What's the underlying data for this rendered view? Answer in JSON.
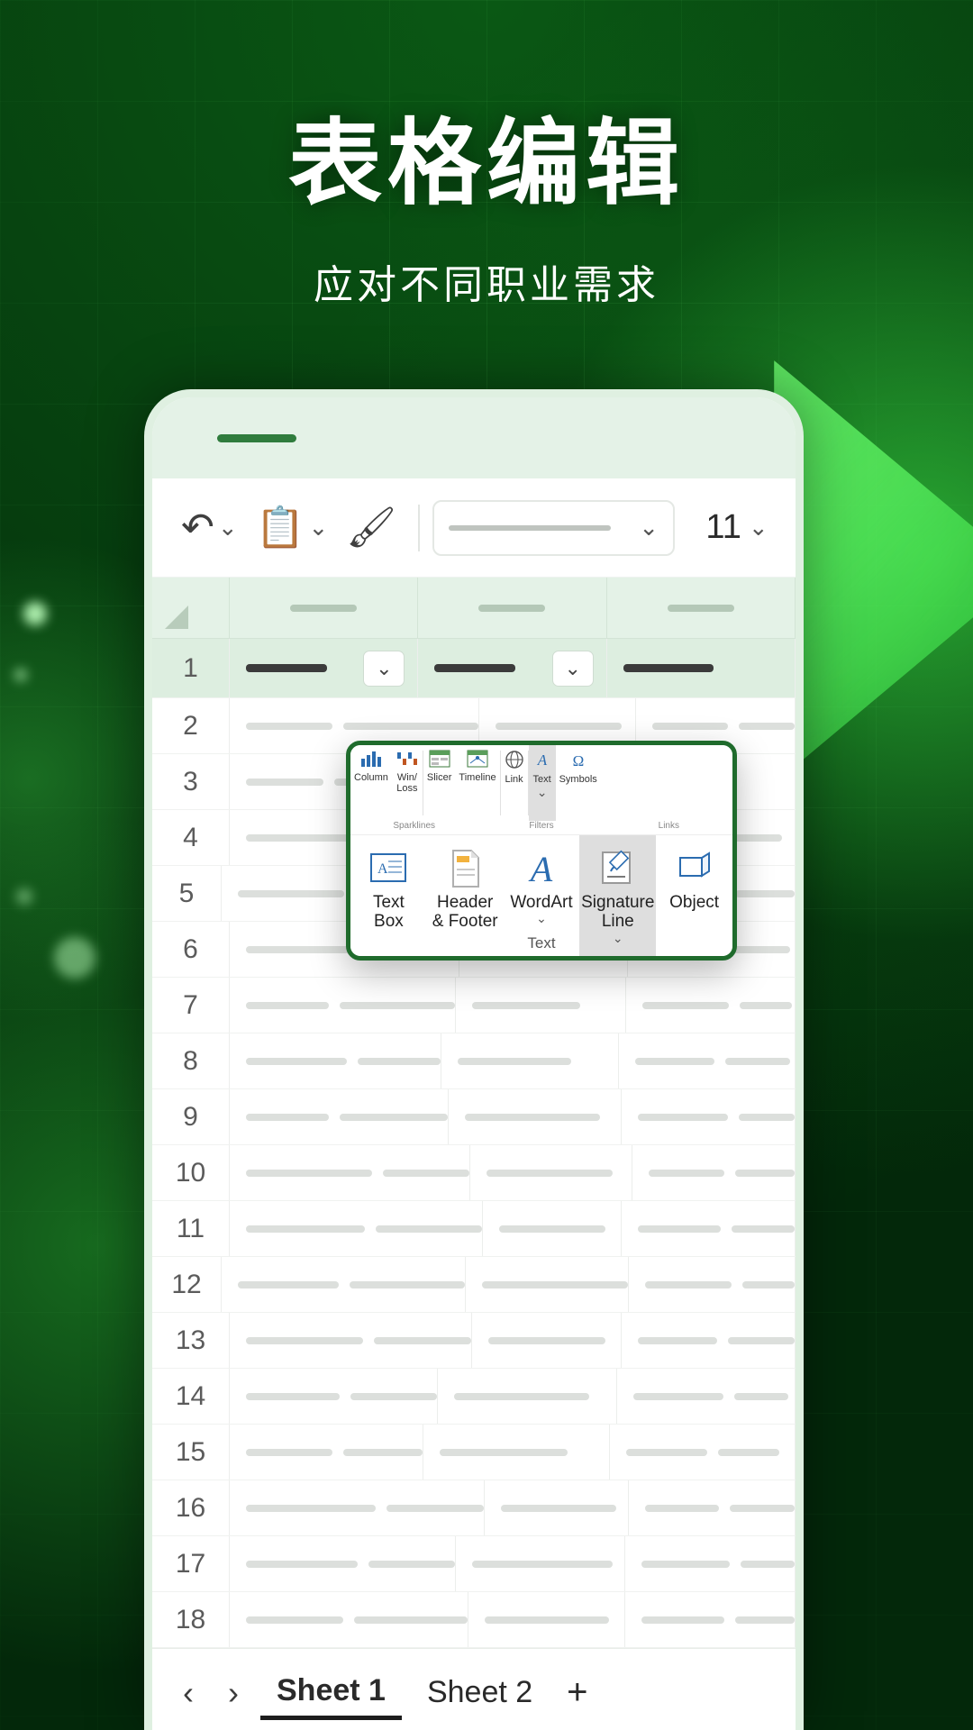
{
  "promo": {
    "headline": "表格编辑",
    "subhead": "应对不同职业需求"
  },
  "colors": {
    "brand_green": "#1f6b2c",
    "accent_glow": "#6dff6d",
    "sheet_header": "#e4f2e7",
    "selected_row": "#ddeee0"
  },
  "toolbar": {
    "undo_icon": "undo-icon",
    "undo_label": "↶",
    "paste_icon": "clipboard-icon",
    "paste_label": "📋",
    "format_painter_icon": "format-painter-icon",
    "format_painter_label": "🖌",
    "font_name": "",
    "font_size": "11",
    "dropdown_caret": "⌄"
  },
  "sheet": {
    "row_numbers": [
      "1",
      "2",
      "3",
      "4",
      "5",
      "6",
      "7",
      "8",
      "9",
      "10",
      "11",
      "12",
      "13",
      "14",
      "15",
      "16",
      "17",
      "18"
    ],
    "column_count": 3,
    "filter_caret": "⌄",
    "selected_row": "1"
  },
  "sheet_tabs": {
    "prev_label": "‹",
    "next_label": "›",
    "tabs": [
      {
        "label": "Sheet 1",
        "active": true
      },
      {
        "label": "Sheet 2",
        "active": false
      }
    ],
    "add_label": "+"
  },
  "ribbon": {
    "top_items": [
      {
        "label": "Column",
        "icon": "column-chart-icon",
        "glyph": "▟",
        "selected": false
      },
      {
        "label": "Win/\nLoss",
        "icon": "win-loss-chart-icon",
        "glyph": "▆",
        "selected": false
      },
      {
        "label": "Slicer",
        "icon": "slicer-icon",
        "glyph": "▤",
        "selected": false
      },
      {
        "label": "Timeline",
        "icon": "timeline-icon",
        "glyph": "▥",
        "selected": false
      },
      {
        "label": "Link",
        "icon": "link-globe-icon",
        "glyph": "🌐",
        "selected": false
      },
      {
        "label": "Text",
        "icon": "text-icon",
        "glyph": "A",
        "selected": true
      },
      {
        "label": "Symbols",
        "icon": "omega-symbol-icon",
        "glyph": "Ω",
        "selected": false
      }
    ],
    "group_labels": [
      "Sparklines",
      "Filters",
      "Links"
    ],
    "main_items": [
      {
        "label": "Text\nBox",
        "icon": "text-box-icon",
        "selected": false,
        "has_caret": false
      },
      {
        "label": "Header\n& Footer",
        "icon": "header-footer-icon",
        "selected": false,
        "has_caret": false
      },
      {
        "label": "WordArt",
        "icon": "wordart-icon",
        "selected": false,
        "has_caret": true
      },
      {
        "label": "Signature\nLine",
        "icon": "signature-line-icon",
        "selected": true,
        "has_caret": true
      },
      {
        "label": "Object",
        "icon": "object-icon",
        "selected": false,
        "has_caret": false
      }
    ],
    "main_group_label": "Text",
    "caret_glyph": "⌄"
  }
}
